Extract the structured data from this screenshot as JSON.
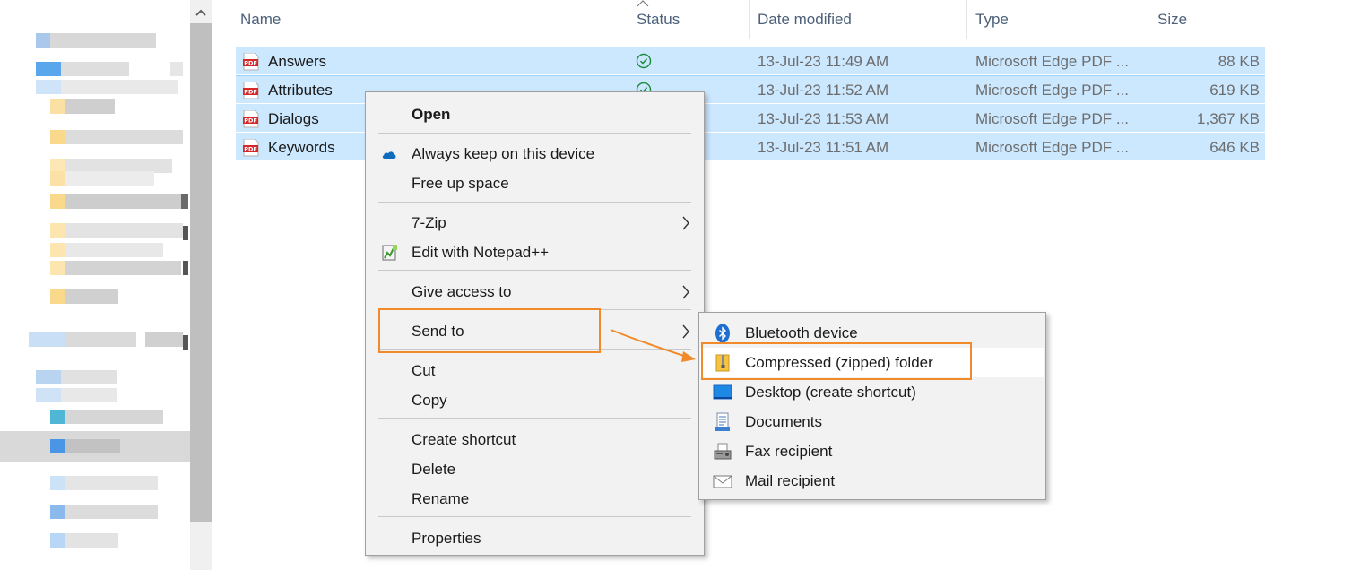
{
  "columns": {
    "name": "Name",
    "status": "Status",
    "date": "Date modified",
    "type": "Type",
    "size": "Size"
  },
  "files": [
    {
      "name": "Answers",
      "date": "13-Jul-23 11:49 AM",
      "type": "Microsoft Edge PDF ...",
      "size": "88 KB",
      "synced": true
    },
    {
      "name": "Attributes",
      "date": "13-Jul-23 11:52 AM",
      "type": "Microsoft Edge PDF ...",
      "size": "619 KB",
      "synced": true
    },
    {
      "name": "Dialogs",
      "date": "13-Jul-23 11:53 AM",
      "type": "Microsoft Edge PDF ...",
      "size": "1,367 KB",
      "synced": false
    },
    {
      "name": "Keywords",
      "date": "13-Jul-23 11:51 AM",
      "type": "Microsoft Edge PDF ...",
      "size": "646 KB",
      "synced": false
    }
  ],
  "file_icon_label": "PDF",
  "context_menu": {
    "open": "Open",
    "always_keep": "Always keep on this device",
    "free_up": "Free up space",
    "seven_zip": "7-Zip",
    "notepad": "Edit with Notepad++",
    "give_access": "Give access to",
    "send_to": "Send to",
    "cut": "Cut",
    "copy": "Copy",
    "create_shortcut": "Create shortcut",
    "delete": "Delete",
    "rename": "Rename",
    "properties": "Properties"
  },
  "send_to_menu": {
    "bluetooth": "Bluetooth device",
    "compressed": "Compressed (zipped) folder",
    "desktop": "Desktop (create shortcut)",
    "documents": "Documents",
    "fax": "Fax recipient",
    "mail": "Mail recipient"
  },
  "colors": {
    "selection": "#cce8ff",
    "highlight": "#f08a2a",
    "menu_bg": "#f2f2f2",
    "onedrive": "#0f6cbd",
    "synced_check": "#1e8a3c"
  }
}
